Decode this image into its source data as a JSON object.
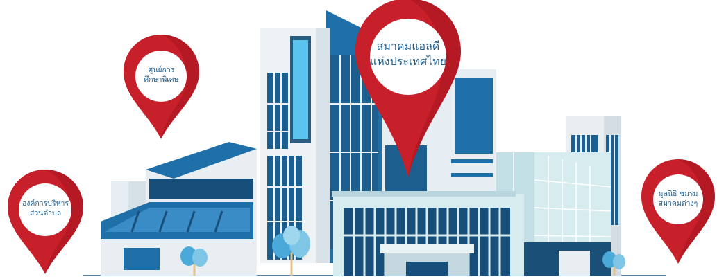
{
  "pins": [
    {
      "id": "main",
      "lines": [
        "สมาคมแอลดี",
        "แห่งประเทศไทย"
      ]
    },
    {
      "id": "special-education-center",
      "lines": [
        "ศูนย์การ",
        "ศึกษาพิเศษ"
      ]
    },
    {
      "id": "local-administration",
      "lines": [
        "องค์การบริหาร",
        "ส่วนตำบล"
      ]
    },
    {
      "id": "foundations-associations",
      "lines": [
        "มูลนิธิ ชมรม",
        "สมาคมต่างๆ"
      ]
    }
  ],
  "colors": {
    "pin_red": "#c8202b",
    "pin_dark_red": "#8f1219",
    "pin_text": "#1f5f8f",
    "building_blue": "#1f6fa8",
    "building_dark": "#174f7a",
    "building_light": "#e6eef4",
    "glass_light": "#cfe8ee",
    "tree_blue": "#4aa9d8",
    "ground": "#5b7f9a"
  }
}
